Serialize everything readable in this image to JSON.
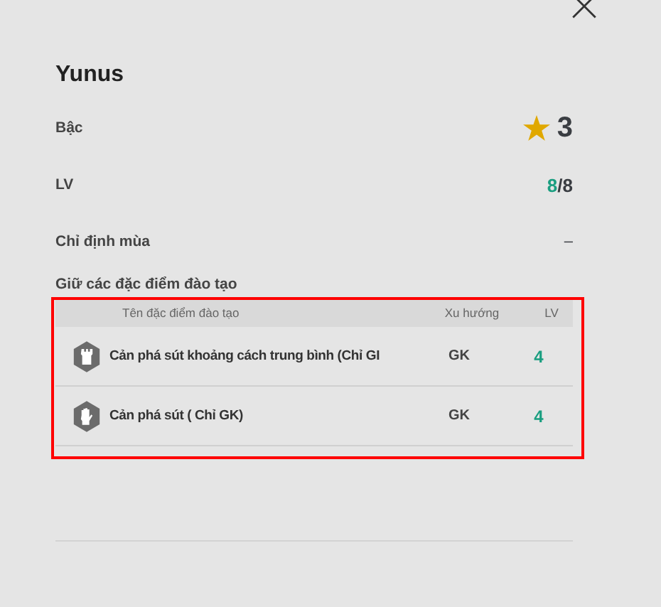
{
  "title": "Yunus",
  "stats": [
    {
      "label": "Bậc",
      "kind": "grade",
      "value": "3"
    },
    {
      "label": "LV",
      "kind": "level",
      "current": "8",
      "max": "/8"
    },
    {
      "label": "Chỉ định mùa",
      "kind": "plain",
      "value": "–"
    }
  ],
  "traits_heading": "Giữ các đặc điểm đào tạo",
  "table": {
    "columns": [
      "Tên đặc điểm đào tạo",
      "Xu hướng",
      "LV"
    ],
    "rows": [
      {
        "kind": "tower",
        "name": "Cản phá sút khoảng cách trung bình (Chỉ GI",
        "position": "GK",
        "lv": "4"
      },
      {
        "kind": "glove",
        "name": "Cản phá sút ( Chỉ GK)",
        "position": "GK",
        "lv": "4"
      }
    ]
  }
}
